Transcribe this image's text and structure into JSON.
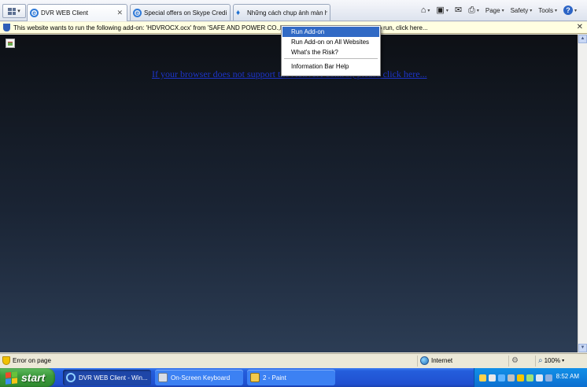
{
  "tabs": [
    {
      "label": "DVR WEB Client",
      "active": true
    },
    {
      "label": "Special offers on Skype Credi...",
      "active": false
    },
    {
      "label": "Những cách chụp ảnh màn hì...",
      "active": false
    }
  ],
  "command_bar": {
    "page_label": "Page",
    "safety_label": "Safety",
    "tools_label": "Tools"
  },
  "info_bar": {
    "text": "This website wants to run the following add-on: 'HDVROCX.ocx' from 'SAFE AND POWER CO.,LTD'... add-on and want to allow it to run, click here..."
  },
  "content": {
    "link_text": "If your browser does not support the ActiveX control, please click here..."
  },
  "context_menu": {
    "items": [
      {
        "label": "Run Add-on",
        "selected": true
      },
      {
        "label": "Run Add-on on All Websites",
        "selected": false
      },
      {
        "label": "What's the Risk?",
        "selected": false
      },
      {
        "label": "Information Bar Help",
        "selected": false
      }
    ]
  },
  "status_bar": {
    "text": "Error on page",
    "zone": "Internet",
    "zoom": "100%"
  },
  "taskbar": {
    "start_label": "start",
    "tasks": [
      {
        "label": "DVR WEB Client - Win...",
        "active": true
      },
      {
        "label": "On-Screen Keyboard",
        "active": false
      },
      {
        "label": "2 - Paint",
        "active": false
      }
    ],
    "clock": "8:52 AM"
  },
  "colors": {
    "menu_highlight": "#316ac5",
    "link": "#1d34c8",
    "taskbar": "#245edc",
    "start_button": "#3c9b3c"
  }
}
